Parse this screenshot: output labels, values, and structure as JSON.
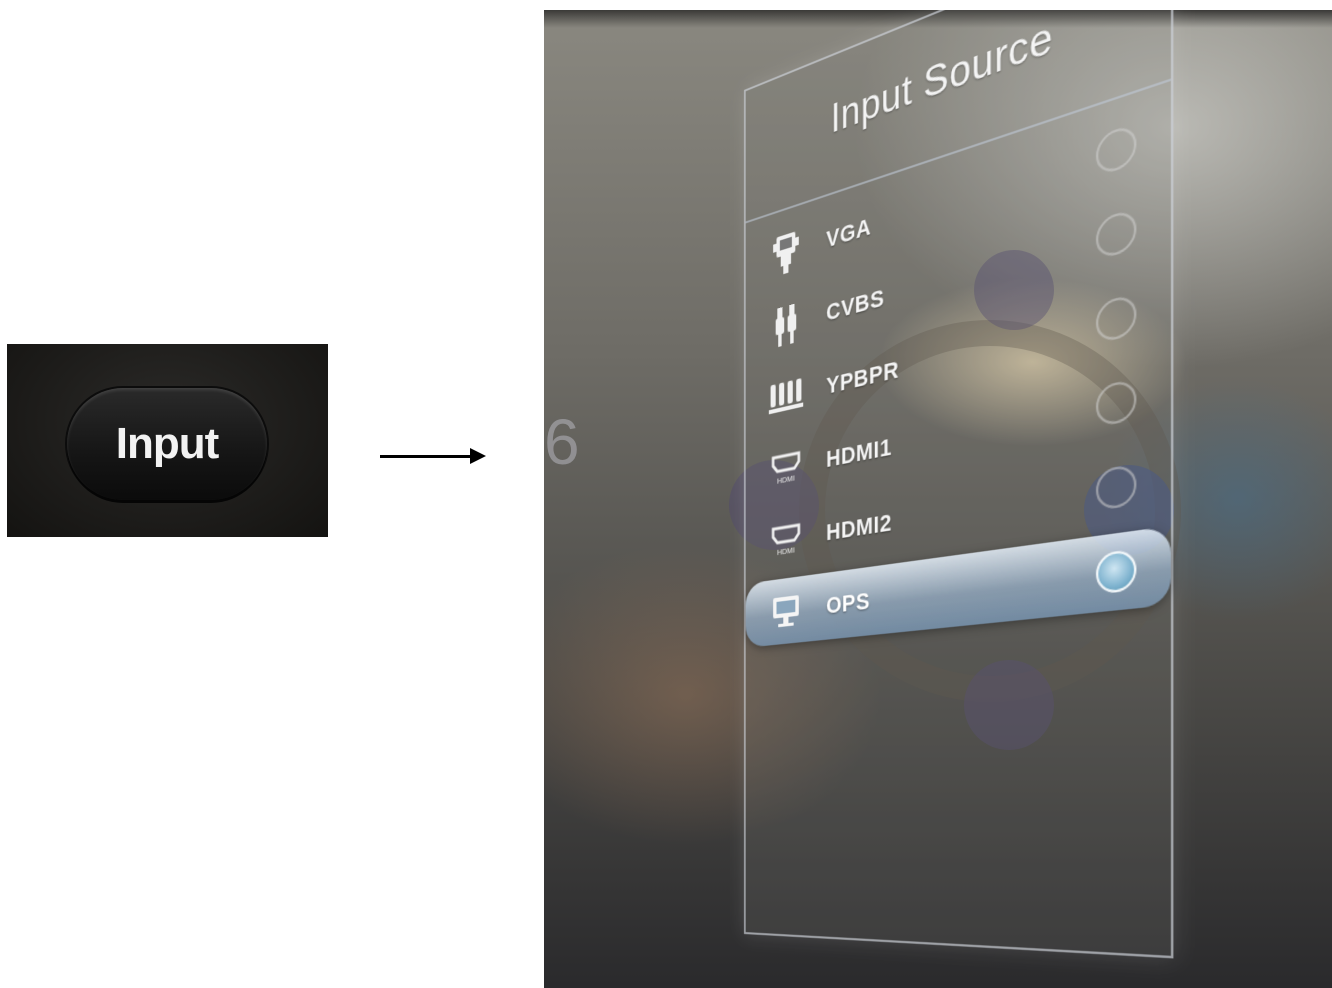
{
  "remote": {
    "button_label": "Input"
  },
  "menu": {
    "title": "Input Source",
    "items": [
      {
        "label": "VGA",
        "icon": "vga-connector-icon",
        "selected": false
      },
      {
        "label": "CVBS",
        "icon": "rca-connector-icon",
        "selected": false
      },
      {
        "label": "YPBPR",
        "icon": "component-connector-icon",
        "selected": false
      },
      {
        "label": "HDMI1",
        "icon": "hdmi-port-icon",
        "icon_text": "HDMI",
        "selected": false
      },
      {
        "label": "HDMI2",
        "icon": "hdmi-port-icon",
        "icon_text": "HDMI",
        "selected": false
      },
      {
        "label": "OPS",
        "icon": "pc-monitor-icon",
        "selected": true
      }
    ]
  },
  "background": {
    "partial_text": "6"
  },
  "colors": {
    "selection_highlight": "#a9c2d8",
    "panel_border": "#d2d7e1"
  }
}
